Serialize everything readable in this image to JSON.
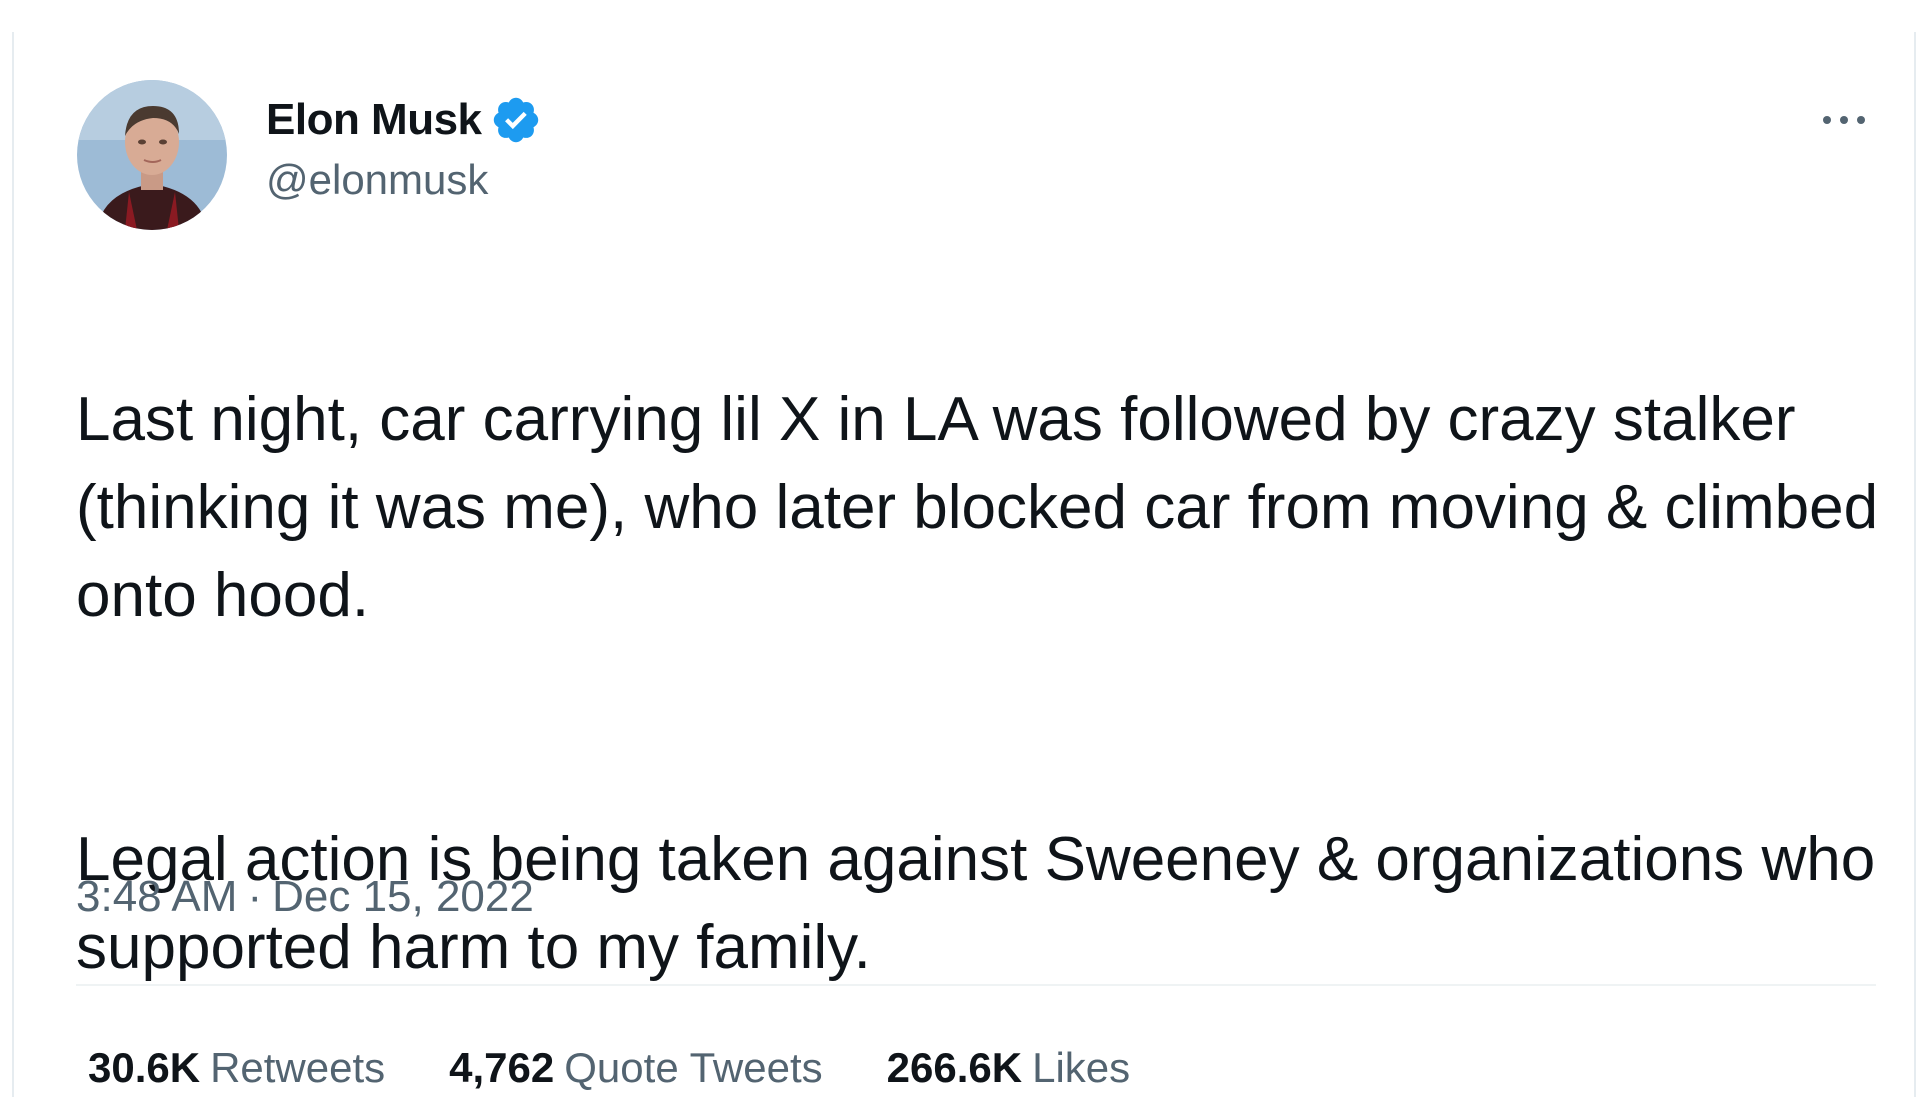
{
  "tweet": {
    "author": {
      "name": "Elon Musk",
      "handle": "@elonmusk",
      "verified_icon": "verified-badge-icon",
      "verified_color": "#1d9bf0"
    },
    "more_icon": "more-options-icon",
    "paragraphs": [
      "Last night, car carrying lil X in LA was followed by crazy stalker (thinking it was me), who later blocked car from moving & climbed onto hood.",
      "Legal action is being taken against Sweeney & organizations who supported harm to my family."
    ],
    "time": "3:48 AM",
    "separator": "·",
    "date": "Dec 15, 2022",
    "stats": {
      "retweets_value": "30.6K",
      "retweets_label": "Retweets",
      "quotes_value": "4,762",
      "quotes_label": "Quote Tweets",
      "likes_value": "266.6K",
      "likes_label": "Likes"
    }
  },
  "colors": {
    "text_primary": "#0f1419",
    "text_secondary": "#536471",
    "divider": "#eff3f4"
  }
}
